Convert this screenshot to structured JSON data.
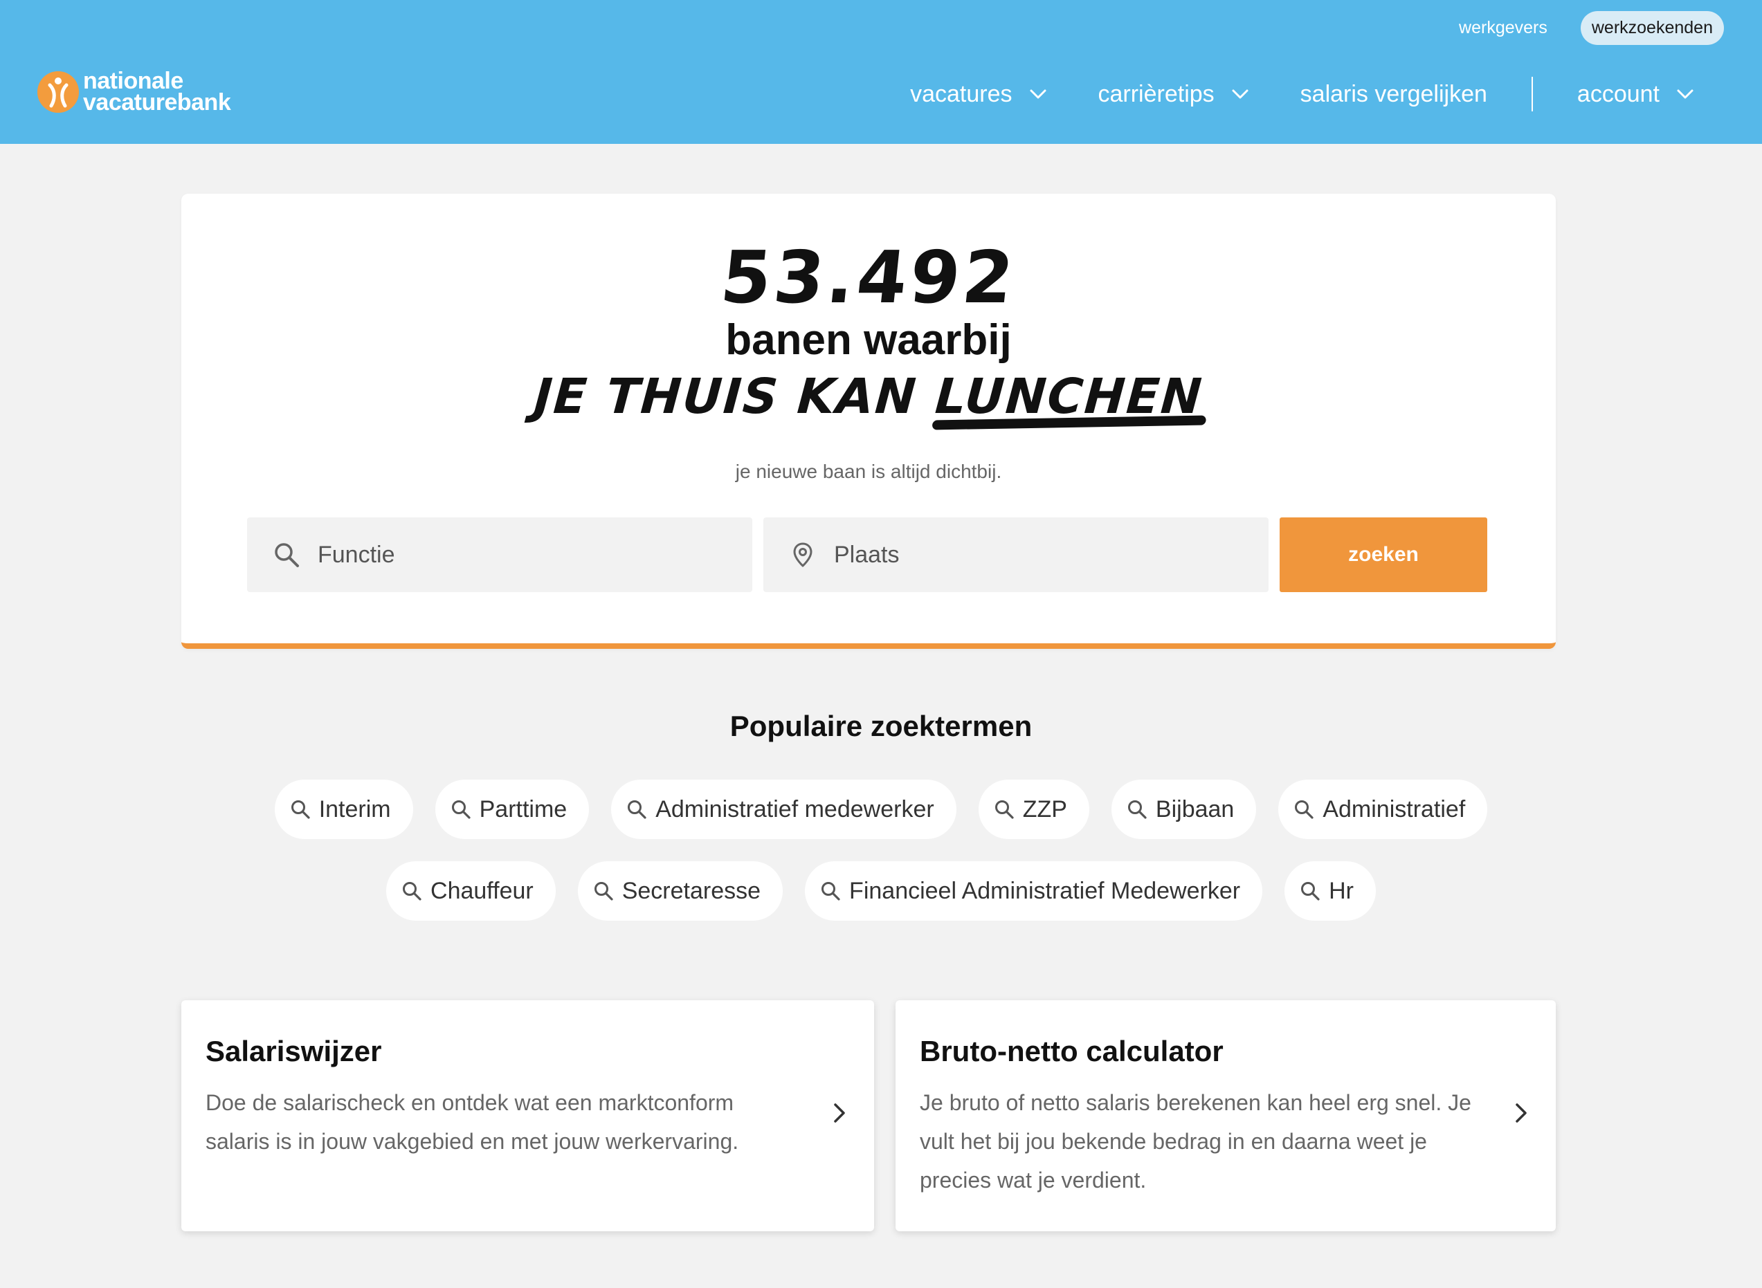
{
  "top_links": {
    "employers": "werkgevers",
    "jobseekers": "werkzoekenden"
  },
  "logo": {
    "line1": "nationale",
    "line2": "vacaturebank",
    "icon": "person-logo-icon",
    "color": "#f39c3d"
  },
  "nav": {
    "vacancies": "vacatures",
    "career_tips": "carrièretips",
    "salary_compare": "salaris vergelijken",
    "account": "account"
  },
  "hero": {
    "count": "53.492",
    "line1": "banen waarbij",
    "line2_prefix": "JE THUIS KAN ",
    "line2_underlined": "LUNCHEN",
    "subtitle": "je nieuwe baan is altijd dichtbij.",
    "function_placeholder": "Functie",
    "place_placeholder": "Plaats",
    "search_label": "zoeken"
  },
  "popular": {
    "title": "Populaire zoektermen",
    "row1": [
      "Interim",
      "Parttime",
      "Administratief medewerker",
      "ZZP",
      "Bijbaan",
      "Administratief"
    ],
    "row2": [
      "Chauffeur",
      "Secretaresse",
      "Financieel Administratief Medewerker",
      "Hr"
    ]
  },
  "cards": [
    {
      "title": "Salariswijzer",
      "description": "Doe de salarischeck en ontdek wat een marktconform salaris is in jouw vakgebied en met jouw werkervaring."
    },
    {
      "title": "Bruto-netto calculator",
      "description": "Je bruto of netto salaris berekenen kan heel erg snel. Je vult het bij jou bekende bedrag in en daarna weet je precies wat je verdient."
    }
  ],
  "colors": {
    "header_bg": "#56b8e9",
    "accent_orange": "#f0963c",
    "page_bg": "#f2f2f2"
  }
}
